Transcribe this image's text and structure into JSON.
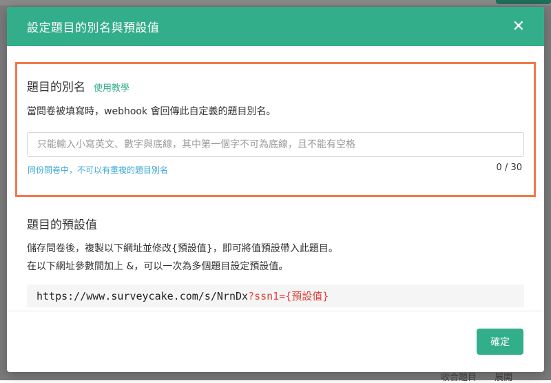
{
  "modal": {
    "title": "設定題目的別名與預設值",
    "close_label": "✕"
  },
  "alias": {
    "heading": "題目的別名",
    "tutorial_link": "使用教學",
    "description": "當問卷被填寫時，webhook 會回傳此自定義的題目別名。",
    "input_value": "",
    "placeholder": "只能輸入小寫英文、數字與底線，其中第一個字不可為底線，且不能有空格",
    "hint": "同份問卷中，不可以有重複的題目別名",
    "counter": "0 / 30"
  },
  "default_value": {
    "heading": "題目的預設值",
    "description_line1": "儲存問卷後，複製以下網址並修改{預設值}，即可將值預設帶入此題目。",
    "description_line2": "在以下網址參數間加上 &，可以一次為多個題目設定預設值。",
    "url_base": "https://www.surveycake.com/s/NrnDx",
    "url_param": "?ssn1={預設值}"
  },
  "footer": {
    "confirm_label": "確定"
  },
  "background": {
    "bottom_items": [
      "收合題目",
      "展開"
    ]
  },
  "colors": {
    "header": "#33ae8a",
    "highlight_border": "#f07a4a",
    "hint": "#3aa9d9",
    "url_param": "#e0443a"
  }
}
